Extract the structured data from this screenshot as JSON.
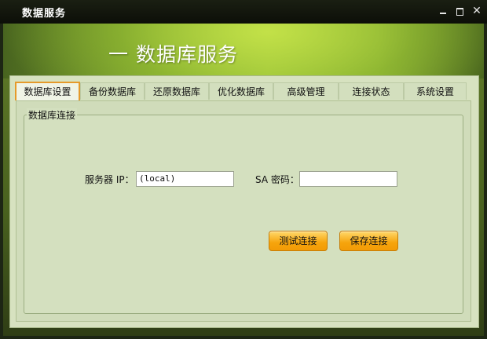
{
  "window": {
    "title": "数据服务",
    "controls": {
      "minimize": "minimize-icon",
      "maximize": "maximize-icon",
      "close": "close-icon"
    }
  },
  "banner": {
    "title": "一 数据库服务"
  },
  "tabs": [
    {
      "label": "数据库设置",
      "active": true
    },
    {
      "label": "备份数据库",
      "active": false
    },
    {
      "label": "还原数据库",
      "active": false
    },
    {
      "label": "优化数据库",
      "active": false
    },
    {
      "label": "高级管理",
      "active": false
    },
    {
      "label": "连接状态",
      "active": false
    },
    {
      "label": "系统设置",
      "active": false
    }
  ],
  "connection_group": {
    "label": "数据库连接",
    "server_ip_label": "服务器 IP：",
    "server_ip_value": "(local)",
    "sa_password_label": "SA 密码：",
    "sa_password_value": ""
  },
  "buttons": {
    "test": "测试连接",
    "save": "保存连接"
  },
  "colors": {
    "accent": "#f6a40c",
    "banner": "#a8cf43",
    "panel": "#d7e2c0"
  }
}
